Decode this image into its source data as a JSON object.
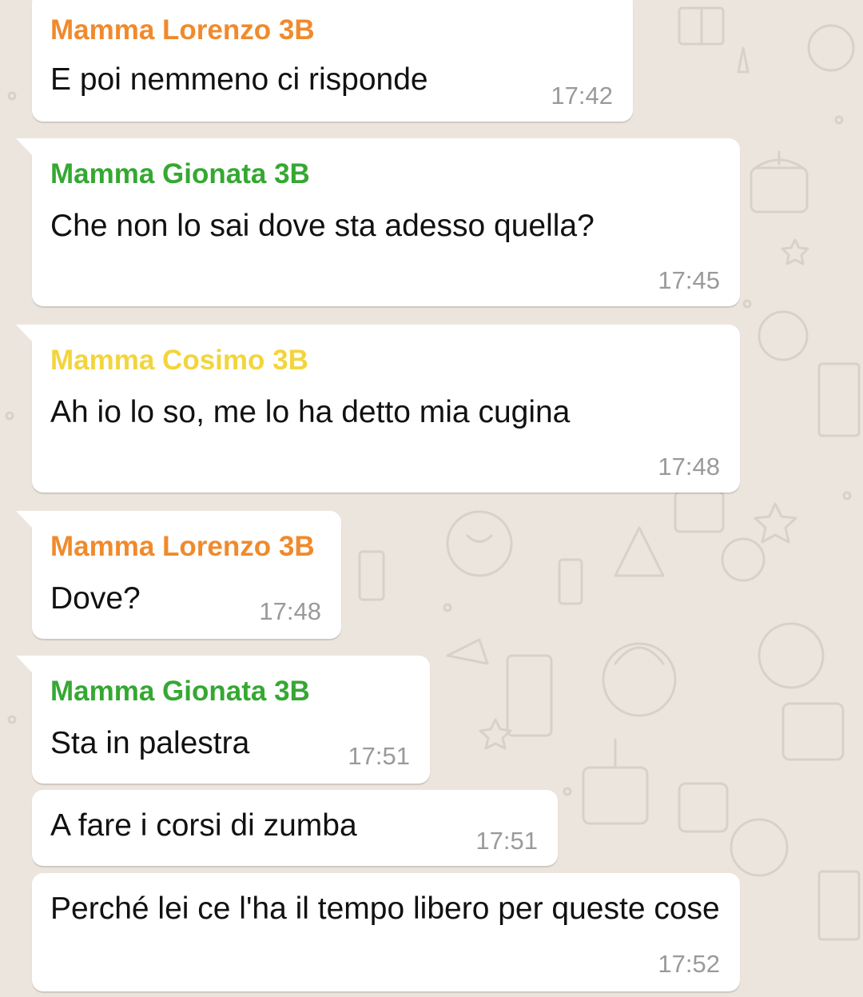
{
  "colors": {
    "background": "#ece5dd",
    "bubble": "#ffffff",
    "sender_orange": "#f08a2c",
    "sender_green": "#35a832",
    "sender_yellow": "#f2d53c",
    "timestamp": "#9a9a9a"
  },
  "background_pattern": "whatsapp-doodle-wallpaper",
  "messages": [
    {
      "sender": "Mamma Lorenzo 3B",
      "text": "E poi nemmeno ci risponde",
      "time": "17:42"
    },
    {
      "sender": "Mamma Gionata 3B",
      "text": "Che non lo sai dove sta adesso quella?",
      "time": "17:45"
    },
    {
      "sender": "Mamma Cosimo 3B",
      "text": "Ah io lo so, me lo ha detto mia cugina",
      "time": "17:48"
    },
    {
      "sender": "Mamma Lorenzo 3B",
      "text": "Dove?",
      "time": "17:48"
    },
    {
      "sender": "Mamma Gionata 3B",
      "text": "Sta in palestra",
      "time": "17:51"
    },
    {
      "sender": "",
      "text": "A fare i corsi di zumba",
      "time": "17:51"
    },
    {
      "sender": "",
      "text": "Perché lei ce l'ha il tempo libero per queste cose",
      "time": "17:52"
    }
  ]
}
